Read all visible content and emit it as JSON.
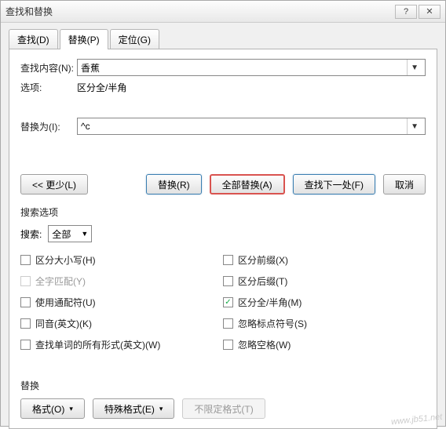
{
  "window": {
    "title": "查找和替换"
  },
  "tabs": {
    "find": "查找(D)",
    "replace": "替换(P)",
    "goto": "定位(G)",
    "active": "replace"
  },
  "fields": {
    "find_label": "查找内容(N):",
    "find_value": "香蕉",
    "options_label": "选项:",
    "options_value": "区分全/半角",
    "replace_label": "替换为(I):",
    "replace_value": "^c"
  },
  "buttons": {
    "less": "<< 更少(L)",
    "replace": "替换(R)",
    "replace_all": "全部替换(A)",
    "find_next": "查找下一处(F)",
    "cancel": "取消"
  },
  "search_options": {
    "title": "搜索选项",
    "search_label": "搜索:",
    "search_value": "全部",
    "left": {
      "match_case": "区分大小写(H)",
      "whole_word": "全字匹配(Y)",
      "wildcards": "使用通配符(U)",
      "sounds_like": "同音(英文)(K)",
      "all_forms": "查找单词的所有形式(英文)(W)"
    },
    "right": {
      "prefix": "区分前缀(X)",
      "suffix": "区分后缀(T)",
      "full_half": "区分全/半角(M)",
      "punct": "忽略标点符号(S)",
      "space": "忽略空格(W)"
    },
    "checked": {
      "full_half": true
    }
  },
  "replace_section": {
    "title": "替换",
    "format": "格式(O)",
    "special": "特殊格式(E)",
    "no_format": "不限定格式(T)"
  },
  "watermark": "www.jb51.net"
}
